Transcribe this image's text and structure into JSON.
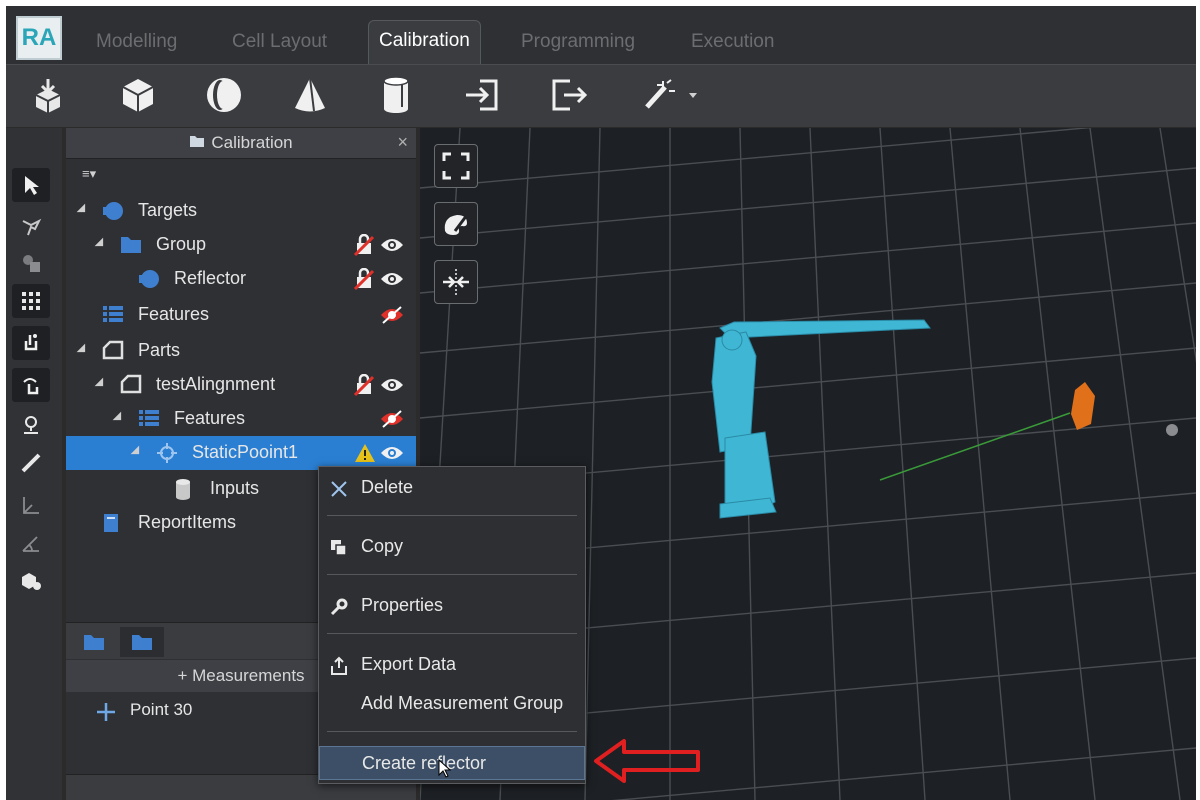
{
  "logo": "RA",
  "tabs": [
    {
      "label": "Modelling"
    },
    {
      "label": "Cell Layout"
    },
    {
      "label": "Calibration",
      "active": true
    },
    {
      "label": "Programming"
    },
    {
      "label": "Execution"
    }
  ],
  "toolbar": {
    "icons": [
      "import-icon",
      "box-icon",
      "sphere-icon",
      "cone-icon",
      "cylinder-icon",
      "login-icon",
      "export-icon",
      "magic-wand-icon"
    ]
  },
  "tree": {
    "title": "Calibration",
    "close_glyph": "×",
    "menu_glyph": "≡▾",
    "items": [
      {
        "label": "Targets"
      },
      {
        "label": "Group"
      },
      {
        "label": "Reflector"
      },
      {
        "label": "Features"
      },
      {
        "label": "Parts"
      },
      {
        "label": "testAlingnment"
      },
      {
        "label": "Features"
      },
      {
        "label": "StaticPooint1"
      },
      {
        "label": "Inputs"
      },
      {
        "label": "ReportItems"
      }
    ]
  },
  "measurements": {
    "title": "+ Measurements",
    "items": [
      {
        "label": "Point 30"
      }
    ]
  },
  "context_menu": {
    "items": [
      {
        "label": "Delete"
      },
      {
        "label": "Copy"
      },
      {
        "label": "Properties"
      },
      {
        "label": "Export Data"
      },
      {
        "label": "Add Measurement Group"
      },
      {
        "label": "Create reflector"
      }
    ]
  },
  "colors": {
    "selected": "#2a7fd3",
    "accent_teal": "#2aa6b8",
    "robot": "#3fb7d4",
    "target": "#e0701a",
    "annotation_arrow": "#e02020"
  }
}
